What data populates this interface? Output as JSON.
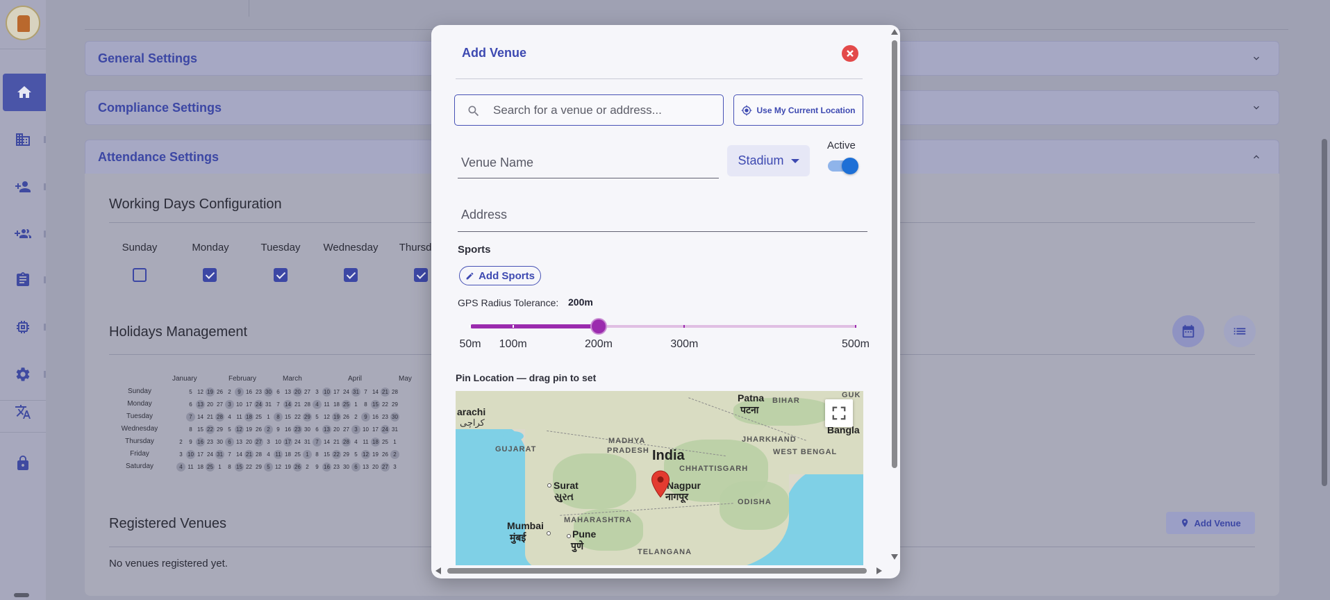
{
  "sidebar": {
    "items": [
      {
        "icon": "home-icon",
        "active": true
      },
      {
        "icon": "building-icon"
      },
      {
        "icon": "person-add-icon"
      },
      {
        "icon": "group-add-icon"
      },
      {
        "icon": "clipboard-icon"
      },
      {
        "icon": "chip-icon"
      },
      {
        "icon": "gear-icon"
      },
      {
        "icon": "translate-icon"
      },
      {
        "icon": "lock-icon"
      }
    ]
  },
  "accordions": {
    "general": "General Settings",
    "compliance": "Compliance Settings",
    "attendance": "Attendance Settings"
  },
  "working_days": {
    "title": "Working Days Configuration",
    "days": [
      {
        "label": "Sunday",
        "checked": false
      },
      {
        "label": "Monday",
        "checked": true
      },
      {
        "label": "Tuesday",
        "checked": true
      },
      {
        "label": "Wednesday",
        "checked": true
      },
      {
        "label": "Thursday",
        "checked": true
      }
    ]
  },
  "holidays": {
    "title": "Holidays Management",
    "months": [
      "January",
      "February",
      "March",
      "April",
      "May"
    ],
    "weekdays": [
      "Sunday",
      "Monday",
      "Tuesday",
      "Wednesday",
      "Thursday",
      "Friday",
      "Saturday"
    ]
  },
  "venues": {
    "title": "Registered Venues",
    "add_label": "Add Venue",
    "empty_text": "No venues registered yet."
  },
  "modal": {
    "title": "Add Venue",
    "search_placeholder": "Search for a venue or address...",
    "use_location_label": "Use My Current Location",
    "venue_name_placeholder": "Venue Name",
    "venue_type": "Stadium",
    "active_label": "Active",
    "active": true,
    "address_placeholder": "Address",
    "sports_label": "Sports",
    "add_sports_label": "Add Sports",
    "gps_label": "GPS Radius Tolerance:",
    "gps_value": "200m",
    "slider": {
      "min": 50,
      "max": 500,
      "value": 200,
      "marks": [
        {
          "value": 50,
          "label": "50m"
        },
        {
          "value": 100,
          "label": "100m"
        },
        {
          "value": 200,
          "label": "200m"
        },
        {
          "value": 300,
          "label": "300m"
        },
        {
          "value": 500,
          "label": "500m"
        }
      ]
    },
    "pin_label": "Pin Location — drag pin to set",
    "map": {
      "country": "India",
      "labels": {
        "karachi": "arachi",
        "karachi_ur": "کراچی",
        "gujarat": "GUJARAT",
        "madhya_pradesh_1": "MADHYA",
        "madhya_pradesh_2": "PRADESH",
        "patna": "Patna",
        "patna_hi": "पटना",
        "bihar": "BIHAR",
        "jharkhand": "JHARKHAND",
        "west_bengal": "WEST BENGAL",
        "bangla": "Bangla",
        "guk": "GUK",
        "chhattisgarh": "CHHATTISGARH",
        "surat": "Surat",
        "surat_gu": "સુરત",
        "nagpur": "Nagpur",
        "nagpur_hi": "नागपूर",
        "odisha": "ODISHA",
        "maharashtra": "MAHARASHTRA",
        "mumbai": "Mumbai",
        "mumbai_hi": "मुंबई",
        "pune": "Pune",
        "pune_hi": "पुणे",
        "telangana": "TELANGANA"
      }
    }
  }
}
